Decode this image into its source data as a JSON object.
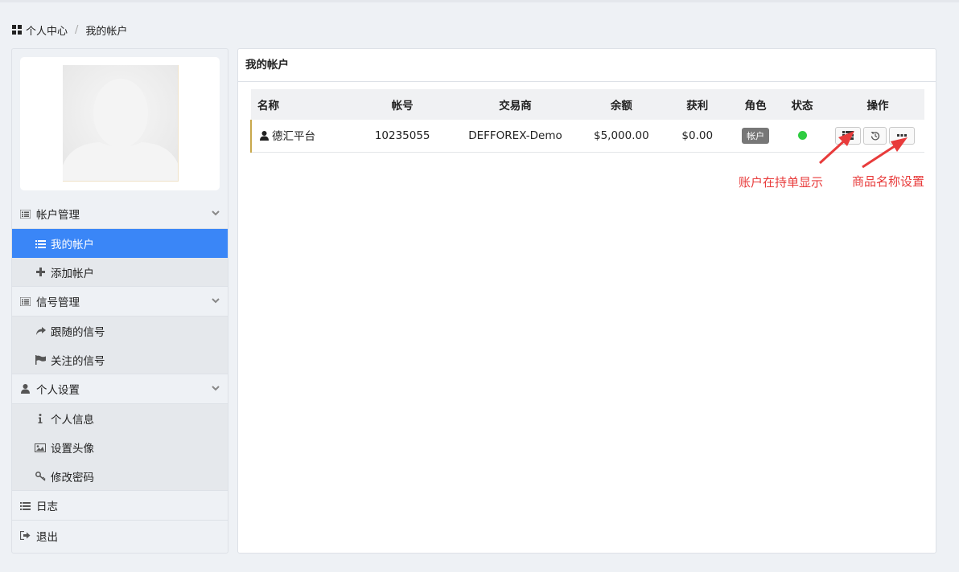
{
  "breadcrumb": {
    "home": "个人中心",
    "separator": "/",
    "current": "我的帐户"
  },
  "sidebar": {
    "sections": [
      {
        "label": "帐户管理",
        "items": [
          "我的帐户",
          "添加帐户"
        ]
      },
      {
        "label": "信号管理",
        "items": [
          "跟随的信号",
          "关注的信号"
        ]
      },
      {
        "label": "个人设置",
        "items": [
          "个人信息",
          "设置头像",
          "修改密码"
        ]
      }
    ],
    "log": "日志",
    "logout": "退出"
  },
  "panel": {
    "title": "我的帐户",
    "columns": [
      "名称",
      "帐号",
      "交易商",
      "余额",
      "获利",
      "角色",
      "状态",
      "操作"
    ],
    "rows": [
      {
        "name": "德汇平台",
        "account": "10235055",
        "broker": "DEFFOREX-Demo",
        "balance": "$5,000.00",
        "profit": "$0.00",
        "role": "帐户",
        "status": "online"
      }
    ]
  },
  "annotations": {
    "left": "账户在持单显示",
    "right": "商品名称设置"
  },
  "colors": {
    "accent": "#3a86f7",
    "status_online": "#2ecc40",
    "annotation": "#e83b3b",
    "row_marker": "#c8a84c"
  }
}
